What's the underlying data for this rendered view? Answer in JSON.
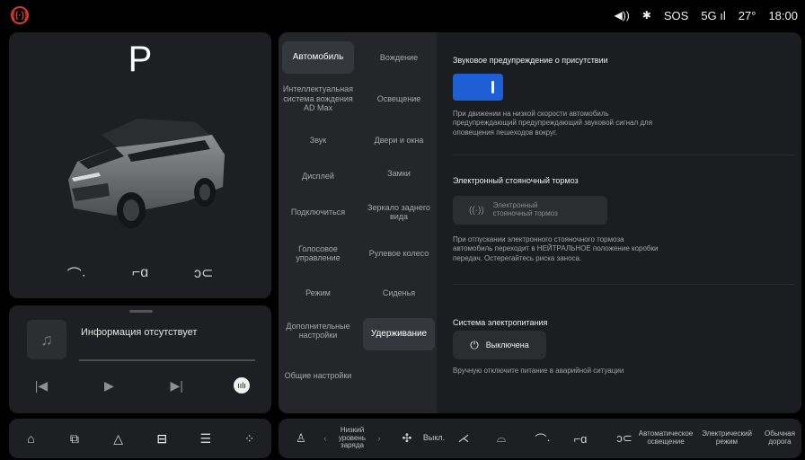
{
  "status": {
    "brake_warning": "(P)",
    "volume_icon": "speaker-icon",
    "bluetooth_icon": "bluetooth-icon",
    "sos": "SOS",
    "network": "5G",
    "temperature": "27°",
    "time": "18:00"
  },
  "vehicle": {
    "gear": "P"
  },
  "media": {
    "title": "Информация отсутствует"
  },
  "menu": {
    "items": [
      {
        "label": "Автомобиль"
      },
      {
        "label": "Вождение"
      },
      {
        "label": "Интеллектуальная система вождения AD Max"
      },
      {
        "label": "Освещение"
      },
      {
        "label": "Звук"
      },
      {
        "label": "Двери и окна"
      },
      {
        "label": "Дисплей"
      },
      {
        "label": "Замки"
      },
      {
        "label": "Подключиться"
      },
      {
        "label": "Зеркало заднего вида"
      },
      {
        "label": "Голосовое управление"
      },
      {
        "label": "Рулевое колесо"
      },
      {
        "label": "Режим"
      },
      {
        "label": "Сиденья"
      },
      {
        "label": "Дополнительные настройки"
      },
      {
        "label": "Удерживание"
      },
      {
        "label": "Общие настройки"
      }
    ],
    "active": "Автомобиль"
  },
  "settings": {
    "presence_sound": {
      "title": "Звуковое предупреждение о присутствии",
      "enabled": true,
      "description": "При движении на низкой скорости автомобиль предупреждающий предупреждающий звуковой сигнал для оповещения пешеходов вокруг."
    },
    "epb": {
      "title": "Электронный стояночный тормоз",
      "button_label": "Электронный стояночный тормоз",
      "description": "При отпускании электронного стояночного тормоза автомобиль переходит в НЕЙТРАЛЬНОЕ положение коробки передач. Остерегайтесь риска заноса."
    },
    "power": {
      "title": "Система электропитания",
      "button_label": "Выключена",
      "description": "Вручную отключите питание в аварийной ситуации"
    }
  },
  "dock": {
    "charge_label": "Низкий уровень заряда",
    "fan_label": "Выкл.",
    "auto_lighting_label": "Автоматическое освещение",
    "electric_mode_label": "Электрический режим",
    "normal_road_label": "Обычная дорога"
  },
  "colors": {
    "accent": "#1f5fd6",
    "warning": "#d63a2f",
    "panel": "#1d1f22"
  }
}
